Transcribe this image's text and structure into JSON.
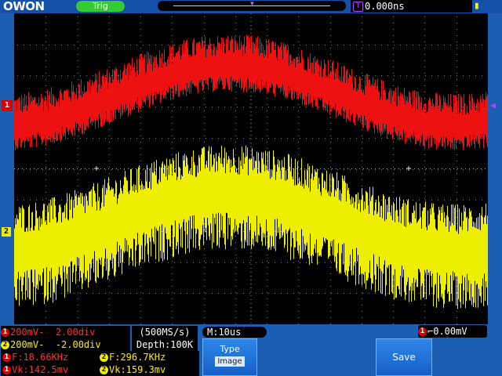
{
  "topbar": {
    "logo": "OWON",
    "trigger_status": "Trig",
    "time_delay": "0.000ns",
    "trigger_pos_marker": "T"
  },
  "markers": {
    "ch1": "1",
    "ch2": "2"
  },
  "channels": [
    {
      "label": "1",
      "scale": "200mV-",
      "offset": "2.00div"
    },
    {
      "label": "2",
      "scale": "200mV-",
      "offset": "-2.00div"
    }
  ],
  "acquisition": {
    "sample_rate": "(500MS/s)",
    "depth": "Depth:100K"
  },
  "timebase": "M:10us",
  "trigger": {
    "channel": "1",
    "level": "0.00mV"
  },
  "measurements": [
    {
      "channel": "1",
      "text": "F:18.66KHz"
    },
    {
      "channel": "2",
      "text": "F:296.7KHz"
    },
    {
      "channel": "1",
      "text": "Vk:142.5mv"
    },
    {
      "channel": "2",
      "text": "Vk:159.3mv"
    }
  ],
  "softkeys": {
    "type_label": "Type",
    "type_value": "Image",
    "save_label": "Save"
  },
  "colors": {
    "ch1": "#ee1111",
    "ch2": "#eeee00",
    "trigger": "#b040ff",
    "frame": "#1a5fb4"
  }
}
